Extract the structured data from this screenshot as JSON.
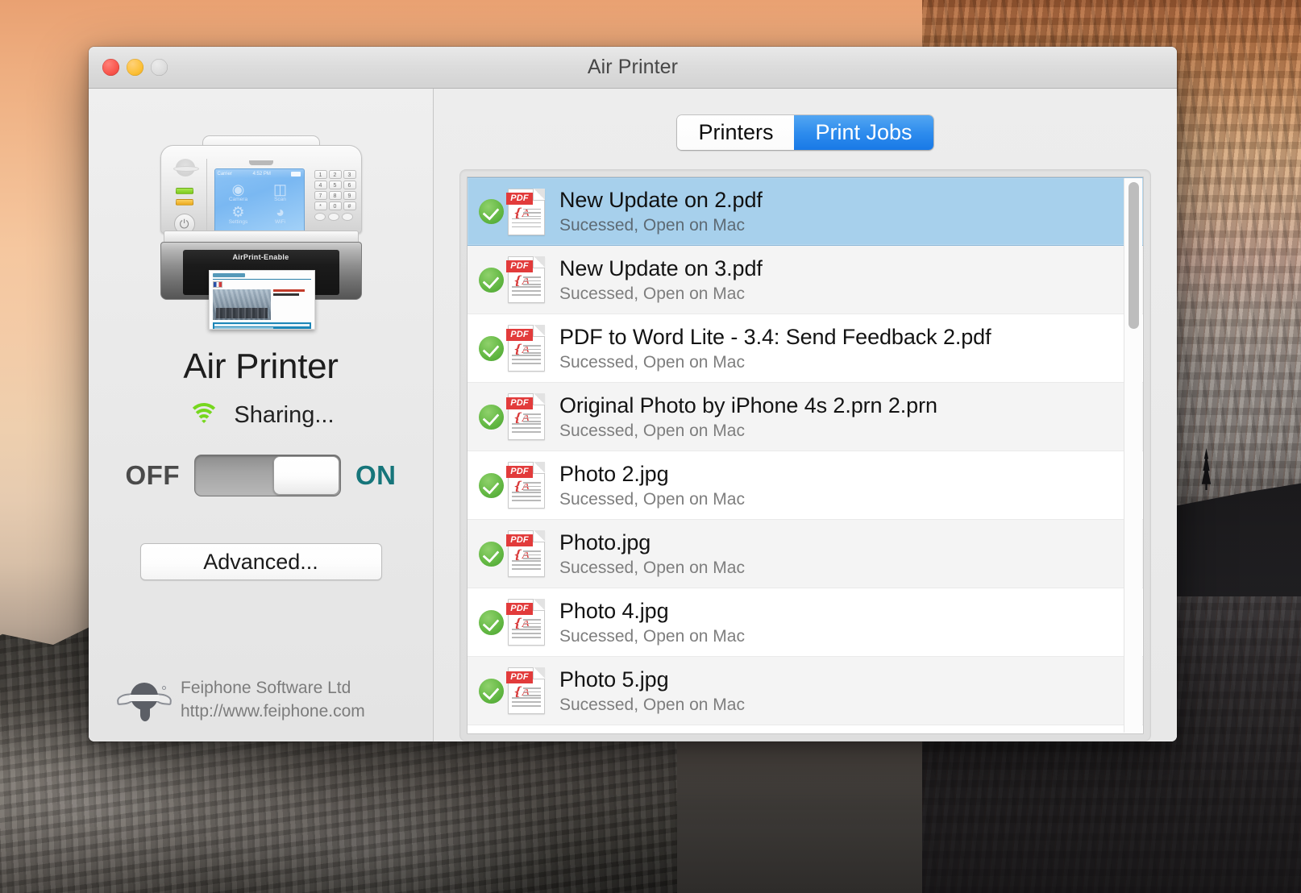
{
  "window": {
    "title": "Air Printer",
    "traffic_lights": [
      "close",
      "minimize",
      "zoom"
    ]
  },
  "sidebar": {
    "printer_illustration": {
      "lcd": {
        "carrier": "Carrier",
        "time": "4:52 PM",
        "apps": [
          {
            "label": "Camera",
            "icon": "camera-icon"
          },
          {
            "label": "Scan",
            "icon": "scanner-icon"
          },
          {
            "label": "Settings",
            "icon": "gear-icon"
          },
          {
            "label": "WiFi",
            "icon": "wifi-icon"
          }
        ]
      },
      "keypad": [
        [
          "1",
          "2",
          "3"
        ],
        [
          "4",
          "5",
          "6"
        ],
        [
          "7",
          "8",
          "9"
        ],
        [
          "*",
          "0",
          "#"
        ]
      ],
      "front_label": "AirPrint-Enable"
    },
    "app_name": "Air Printer",
    "sharing_label": "Sharing...",
    "toggle": {
      "off_label": "OFF",
      "on_label": "ON",
      "state": "on"
    },
    "advanced_button": "Advanced...",
    "footer": {
      "company": "Feiphone Software Ltd",
      "website": "http://www.feiphone.com"
    }
  },
  "rightpane": {
    "tabs": [
      {
        "label": "Printers",
        "active": false
      },
      {
        "label": "Print Jobs",
        "active": true
      }
    ],
    "jobs": [
      {
        "name": "New Update on 2.pdf",
        "status": "Sucessed, Open on Mac",
        "selected": true
      },
      {
        "name": "New Update on 3.pdf",
        "status": "Sucessed, Open on Mac",
        "selected": false
      },
      {
        "name": "PDF to Word Lite - 3.4: Send Feedback 2.pdf",
        "status": "Sucessed, Open on Mac",
        "selected": false
      },
      {
        "name": "Original Photo by iPhone 4s 2.prn 2.prn",
        "status": "Sucessed, Open on Mac",
        "selected": false
      },
      {
        "name": "Photo 2.jpg",
        "status": "Sucessed, Open on Mac",
        "selected": false
      },
      {
        "name": "Photo.jpg",
        "status": "Sucessed, Open on Mac",
        "selected": false
      },
      {
        "name": "Photo 4.jpg",
        "status": "Sucessed, Open on Mac",
        "selected": false
      },
      {
        "name": "Photo 5.jpg",
        "status": "Sucessed, Open on Mac",
        "selected": false
      }
    ]
  },
  "colors": {
    "accent_blue": "#1878e6",
    "selection_blue": "#a7d0ec",
    "success_green": "#63b843",
    "wifi_green": "#76d71e",
    "on_teal": "#16757a",
    "pdf_red": "#e23b3b"
  }
}
